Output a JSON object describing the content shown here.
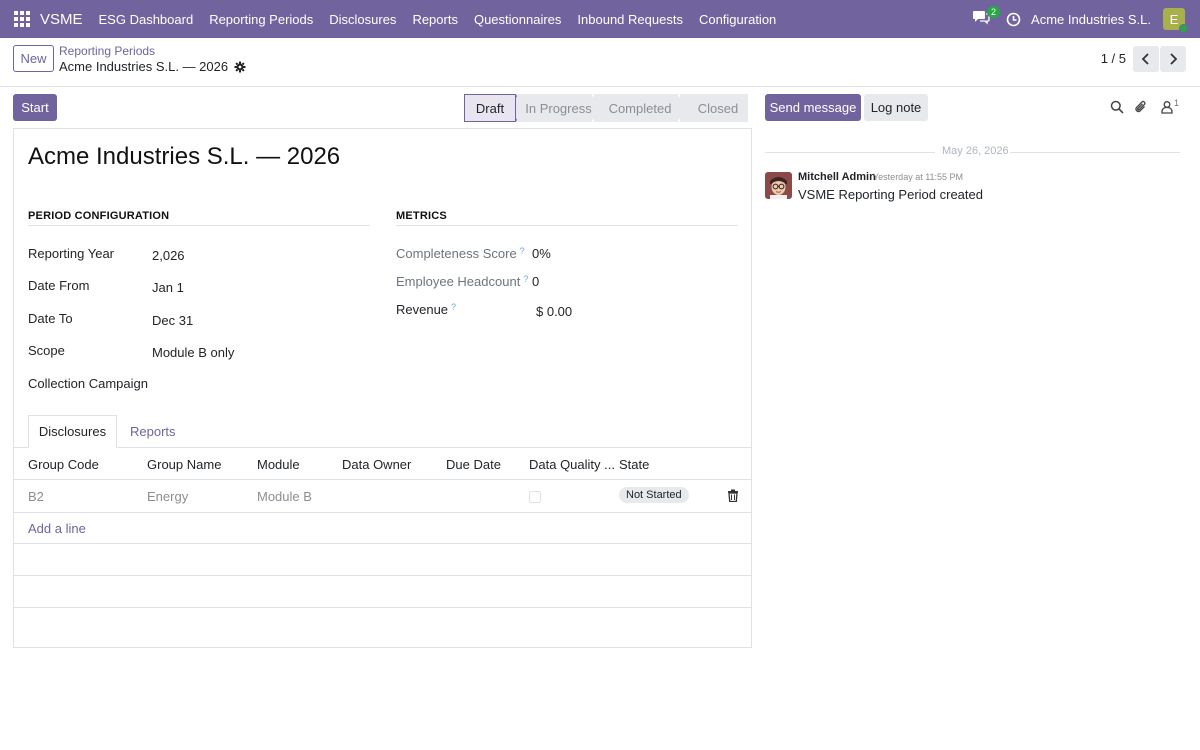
{
  "navbar": {
    "brand": "VSME",
    "items": [
      "ESG Dashboard",
      "Reporting Periods",
      "Disclosures",
      "Reports",
      "Questionnaires",
      "Inbound Requests",
      "Configuration"
    ],
    "messages_count": "2",
    "company": "Acme Industries S.L.",
    "user_initial": "E",
    "colors": {
      "bar": "#71639e",
      "avatar": "#a7b04a",
      "online": "#28a745"
    }
  },
  "control": {
    "new_label": "New",
    "breadcrumb_parent": "Reporting Periods",
    "breadcrumb_current": "Acme Industries S.L. — 2026",
    "pager": "1 / 5"
  },
  "form": {
    "start_label": "Start",
    "stages": [
      "Draft",
      "In Progress",
      "Completed",
      "Closed"
    ],
    "active_stage": "Draft",
    "title": "Acme Industries S.L. — 2026",
    "period_section": "PERIOD CONFIGURATION",
    "metrics_section": "METRICS",
    "fields": {
      "reporting_year": {
        "label": "Reporting Year",
        "value": "2,026"
      },
      "date_from": {
        "label": "Date From",
        "value": "Jan 1"
      },
      "date_to": {
        "label": "Date To",
        "value": "Dec 31"
      },
      "scope": {
        "label": "Scope",
        "value": "Module B only"
      },
      "collection_campaign": {
        "label": "Collection Campaign",
        "value": ""
      },
      "completeness": {
        "label": "Completeness Score",
        "value": "0%"
      },
      "headcount": {
        "label": "Employee Headcount",
        "value": "0"
      },
      "revenue": {
        "label": "Revenue",
        "value": "$ 0.00"
      }
    },
    "help_mark": "?",
    "tabs": [
      "Disclosures",
      "Reports"
    ],
    "table": {
      "columns": [
        "Group Code",
        "Group Name",
        "Module",
        "Data Owner",
        "Due Date",
        "Data Quality ...",
        "State"
      ],
      "rows": [
        {
          "group_code": "B2",
          "group_name": "Energy",
          "module": "Module B",
          "data_owner": "",
          "due_date": "",
          "data_quality": false,
          "state": "Not Started"
        }
      ],
      "add_line": "Add a line"
    }
  },
  "chatter": {
    "send_label": "Send message",
    "log_label": "Log note",
    "followers_count": "1",
    "date_separator": "May 26, 2026",
    "message": {
      "author": "Mitchell Admin",
      "time": "Yesterday at 11:55 PM",
      "body": "VSME Reporting Period created"
    }
  }
}
